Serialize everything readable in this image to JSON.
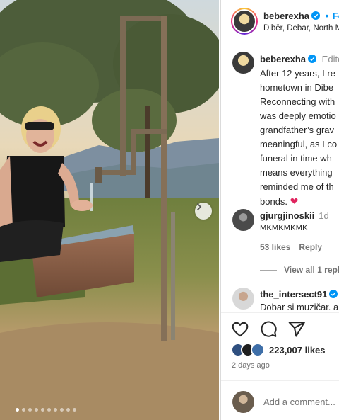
{
  "header": {
    "username": "beberexha",
    "follow_sep": "•",
    "follow_label": "Fo",
    "location": "Dibër, Debar, North M"
  },
  "caption": {
    "username": "beberexha",
    "edited": "Edite",
    "lines": [
      "After 12 years, I re",
      "hometown in Dibe",
      "Reconnecting with",
      "was deeply emotio",
      "grandfather’s grav",
      "meaningful, as I co",
      "funeral in time wh",
      "means everything",
      "reminded me of th",
      "bonds."
    ],
    "emoji": "❤"
  },
  "comments": [
    {
      "username": "gjurgjinoskii",
      "time": "1d",
      "text": "MKMKMKMK",
      "likes": "53 likes",
      "reply": "Reply",
      "view_replies": "View all 1 repli"
    },
    {
      "username": "the_intersect91",
      "text": "Dobar si muzičar. a"
    }
  ],
  "likes": {
    "count": "223,007 likes"
  },
  "posted": "2 days ago",
  "add_comment": {
    "placeholder": "Add a comment..."
  },
  "icons": {
    "verified": "verified-badge-icon",
    "like": "heart-icon",
    "comment": "comment-icon",
    "share": "share-icon",
    "next": "chevron-right-icon"
  },
  "colors": {
    "accent": "#0095f6",
    "text": "#262626",
    "muted": "#737373",
    "heart": "#e0245e"
  },
  "carousel": {
    "slide_count": 10,
    "active_index": 0
  }
}
